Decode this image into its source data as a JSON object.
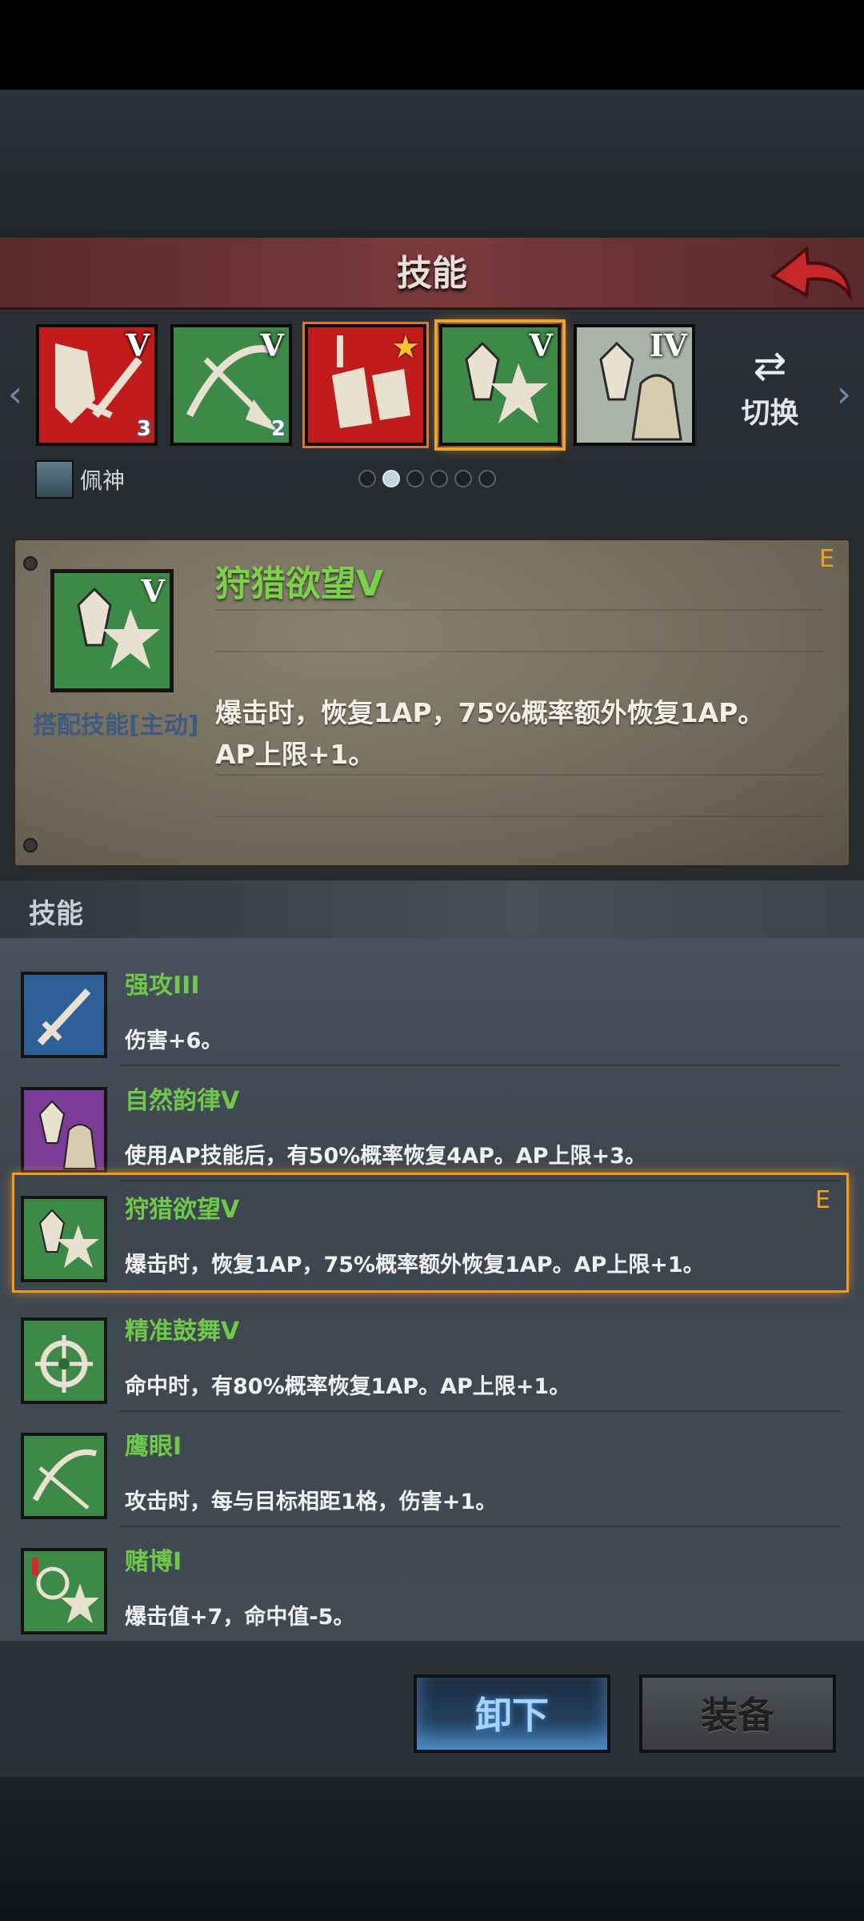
{
  "header": {
    "title": "技能"
  },
  "slots": [
    {
      "rank": "V",
      "gem": "3"
    },
    {
      "rank": "V",
      "gem": "2"
    },
    {
      "rank": ""
    },
    {
      "rank": "V"
    },
    {
      "rank": "IV"
    }
  ],
  "switch_label": "切换",
  "character": {
    "name": "佩神"
  },
  "pager": {
    "total": 6,
    "current": 2
  },
  "detail": {
    "name": "狩猎欲望V",
    "grade": "E",
    "rank": "V",
    "type_label": "搭配技能[主动]",
    "description_line1": "爆击时，恢复1AP，75%概率额外恢复1AP。",
    "description_line2": "AP上限+1。"
  },
  "skills_section_title": "技能",
  "skills": [
    {
      "name": "强攻III",
      "desc": "伤害+6。",
      "grade": ""
    },
    {
      "name": "自然韵律V",
      "desc": "使用AP技能后，有50%概率恢复4AP。AP上限+3。",
      "grade": ""
    },
    {
      "name": "狩猎欲望V",
      "desc": "爆击时，恢复1AP，75%概率额外恢复1AP。AP上限+1。",
      "grade": "E"
    },
    {
      "name": "精准鼓舞V",
      "desc": "命中时，有80%概率恢复1AP。AP上限+1。",
      "grade": ""
    },
    {
      "name": "鹰眼I",
      "desc": "攻击时，每与目标相距1格，伤害+1。",
      "grade": ""
    },
    {
      "name": "赌博I",
      "desc": "爆击值+7，命中值-5。",
      "grade": ""
    }
  ],
  "buttons": {
    "unequip": "卸下",
    "equip": "装备"
  },
  "colors": {
    "accent_orange": "#f49a1e",
    "skill_green": "#6fc84a"
  }
}
